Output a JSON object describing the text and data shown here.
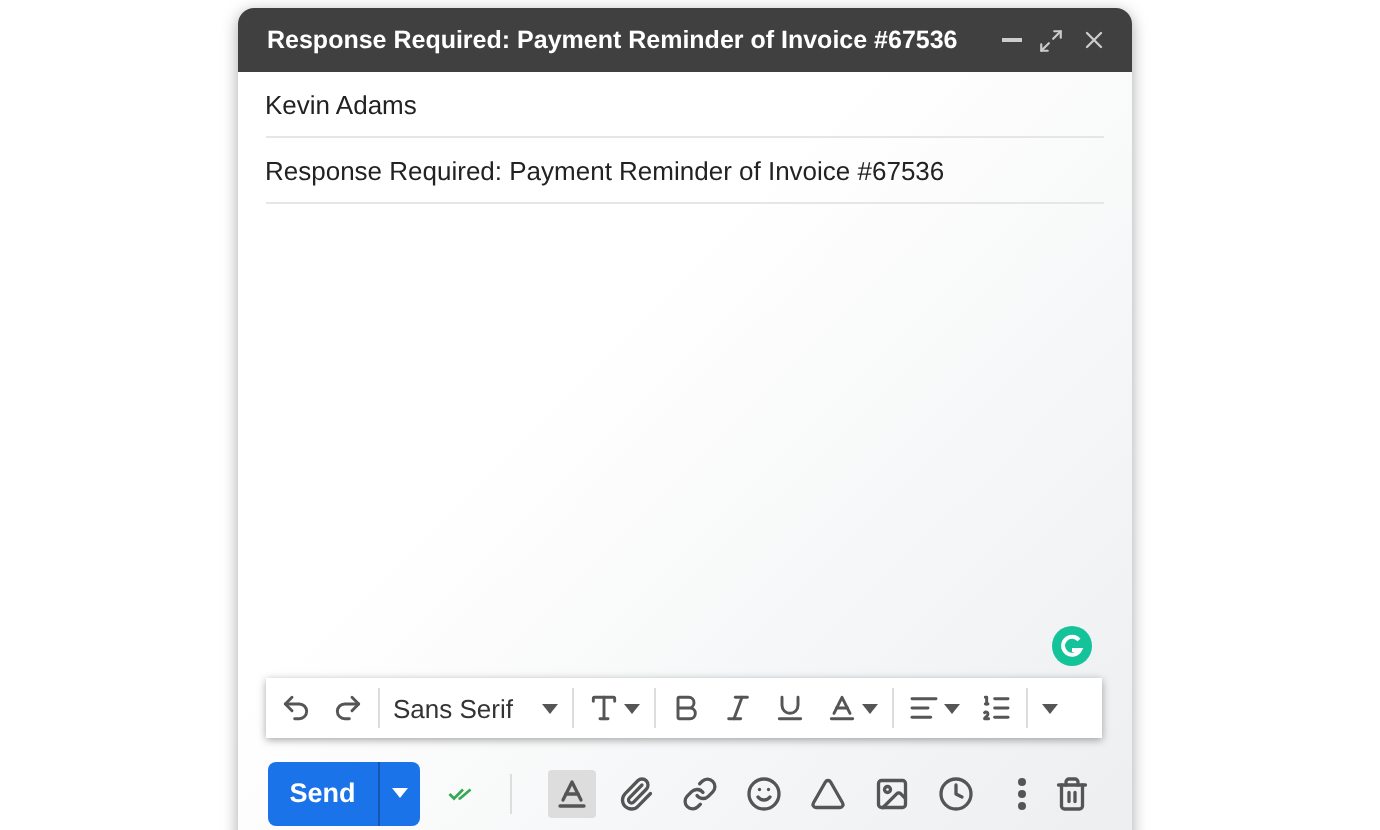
{
  "window": {
    "title": "Response Required: Payment Reminder of Invoice #67536"
  },
  "recipients": "Kevin Adams",
  "subject": "Response Required: Payment Reminder of Invoice #67536",
  "format_bar": {
    "font": "Sans Serif"
  },
  "send_button": {
    "label": "Send"
  },
  "formatting_toggle": {
    "selected": true
  }
}
